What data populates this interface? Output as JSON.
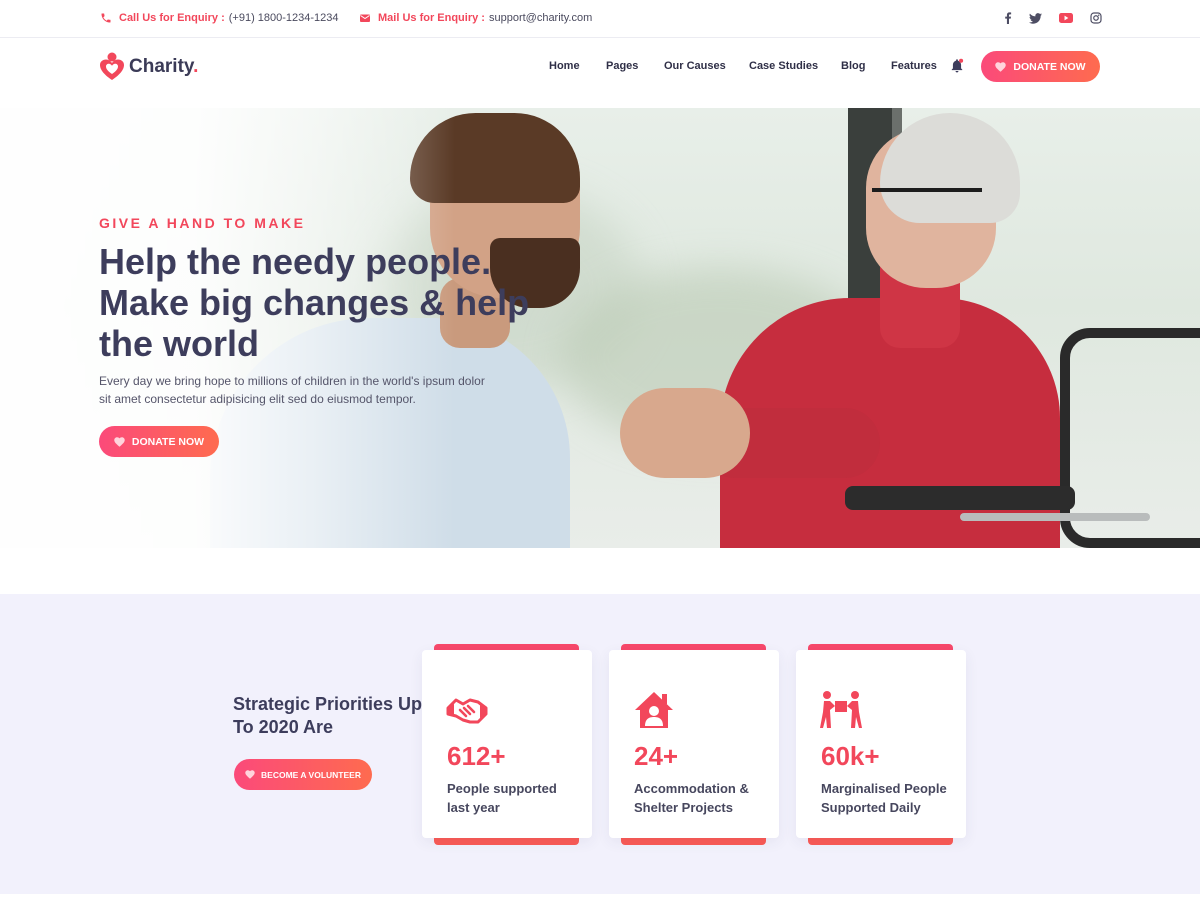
{
  "topbar": {
    "phone_label": "Call Us for Enquiry :",
    "phone_value": "(+91) 1800-1234-1234",
    "mail_label": "Mail Us for Enquiry :",
    "mail_value": "support@charity.com",
    "social": [
      {
        "name": "facebook-icon",
        "glyph": "f"
      },
      {
        "name": "twitter-icon",
        "glyph": "t"
      },
      {
        "name": "youtube-icon",
        "glyph": "y"
      },
      {
        "name": "instagram-icon",
        "glyph": "i"
      }
    ]
  },
  "header": {
    "logo_text": "Charity",
    "logo_dot": ".",
    "nav": [
      "Home",
      "Pages",
      "Our Causes",
      "Case Studies",
      "Blog",
      "Features"
    ],
    "donate_label": "DONATE NOW"
  },
  "hero": {
    "kicker": "GIVE A HAND TO MAKE",
    "title": "Help the needy people. Make big changes & help the world",
    "description": "Every day we bring hope to millions of children in the world's ipsum dolor sit amet consectetur adipisicing elit sed do eiusmod tempor.",
    "button_label": "DONATE NOW"
  },
  "stats": {
    "title": "Strategic Priorities Up To 2020 Are",
    "button_label": "BECOME A VOLUNTEER",
    "cards": [
      {
        "icon": "handshake-icon",
        "number": "612+",
        "label": "People supported last year"
      },
      {
        "icon": "home-person-icon",
        "number": "24+",
        "label": "Accommodation & Shelter Projects"
      },
      {
        "icon": "people-carry-icon",
        "number": "60k+",
        "label": "Marginalised People Supported Daily"
      }
    ]
  },
  "colors": {
    "accent": "#f2475b",
    "gradient_start": "#fb4a7a",
    "gradient_end": "#fe6b4f",
    "heading": "#3d3d5c",
    "stats_bg": "#f2f1fc"
  }
}
